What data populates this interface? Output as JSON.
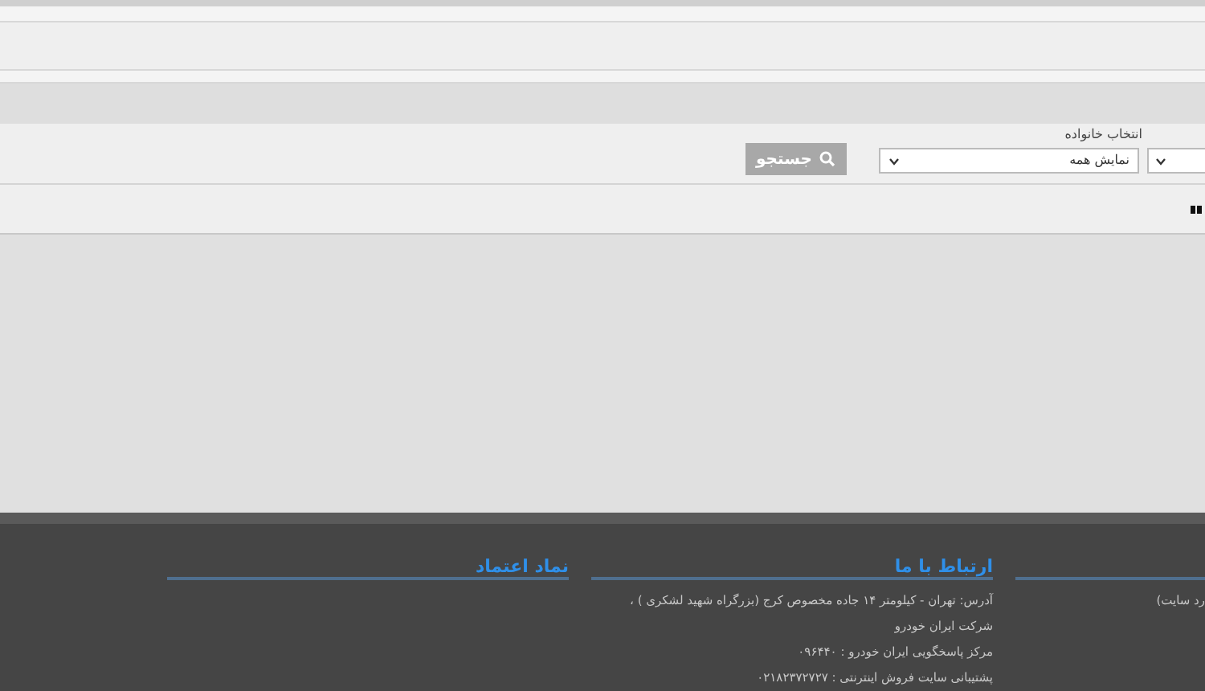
{
  "filter": {
    "label": "انتخاب خانواده",
    "family_select": {
      "value": "نمایش همه"
    },
    "search_button": {
      "label": "جستجو"
    }
  },
  "footer": {
    "columns": [
      {
        "lines": [
          "رد سایت)"
        ]
      },
      {
        "heading": "ارتباط با ما",
        "lines": [
          "آدرس: تهران - کیلومتر ۱۴ جاده مخصوص کرج (بزرگراه شهید لشکری ) ، شرکت ایران خودرو",
          "مرکز پاسخگویی ایران خودرو : ۰۹۶۴۴۰",
          "پشتیبانی سایت فروش اینترنتی : ۰۲۱۸۲۳۷۲۷۲۷"
        ]
      },
      {
        "heading": "نماد اعتماد"
      }
    ]
  }
}
